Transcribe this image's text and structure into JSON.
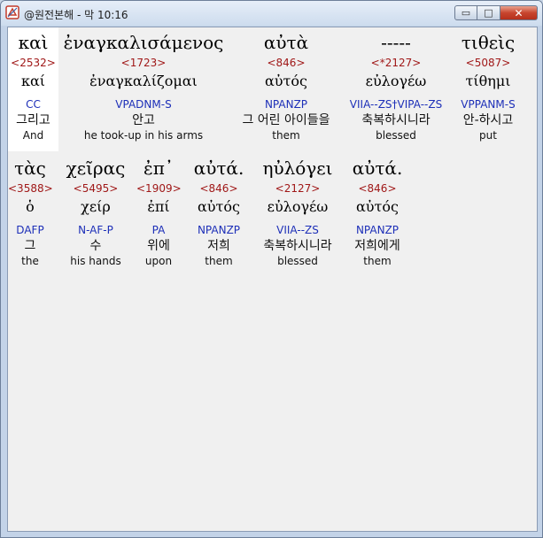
{
  "window": {
    "title": "@원전본해 - 막 10:16",
    "buttons": {
      "minimize": "▭",
      "maximize": "□",
      "close": "✕"
    }
  },
  "colors": {
    "strong": "#a01818",
    "morph": "#1d2fb8",
    "text": "#000000",
    "background": "#f0f0f0"
  },
  "rows": [
    {
      "words": [
        {
          "greek": "καὶ",
          "strong": "<2532>",
          "lemma": "καί",
          "morph": "CC",
          "korean": "그리고",
          "gloss": "And"
        },
        {
          "greek": "ἐναγκαλισάμενος",
          "strong": "<1723>",
          "lemma": "ἐναγκαλίζομαι",
          "morph": "VPADNM-S",
          "korean": "안고",
          "gloss": "he took-up in his arms"
        },
        {
          "greek": "αὐτὰ",
          "strong": "<846>",
          "lemma": "αὐτός",
          "morph": "NPANZP",
          "korean": "그 어린 아이들을",
          "gloss": "them"
        },
        {
          "greek": "-----",
          "strong": "<*2127>",
          "lemma": "εὐλογέω",
          "morph": "VIIA--ZS†VIPA--ZS",
          "korean": "축복하시니라",
          "gloss": "blessed"
        },
        {
          "greek": "τιθεὶς",
          "strong": "<5087>",
          "lemma": "τίθημι",
          "morph": "VPPANM-S",
          "korean": "안-하시고",
          "gloss": "put"
        }
      ]
    },
    {
      "words": [
        {
          "greek": "τὰς",
          "strong": "<3588>",
          "lemma": "ὁ",
          "morph": "DAFP",
          "korean": "그",
          "gloss": "the"
        },
        {
          "greek": "χεῖρας",
          "strong": "<5495>",
          "lemma": "χείρ",
          "morph": "N-AF-P",
          "korean": "수",
          "gloss": "his hands"
        },
        {
          "greek": "ἐπ᾽",
          "strong": "<1909>",
          "lemma": "ἐπί",
          "morph": "PA",
          "korean": "위에",
          "gloss": "upon"
        },
        {
          "greek": "αὐτά.",
          "strong": "<846>",
          "lemma": "αὐτός",
          "morph": "NPANZP",
          "korean": "저희",
          "gloss": "them"
        },
        {
          "greek": "ηὐλόγει",
          "strong": "<2127>",
          "lemma": "εὐλογέω",
          "morph": "VIIA--ZS",
          "korean": "축복하시니라",
          "gloss": "blessed"
        },
        {
          "greek": "αὐτά.",
          "strong": "<846>",
          "lemma": "αὐτός",
          "morph": "NPANZP",
          "korean": "저희에게",
          "gloss": "them"
        }
      ]
    }
  ]
}
